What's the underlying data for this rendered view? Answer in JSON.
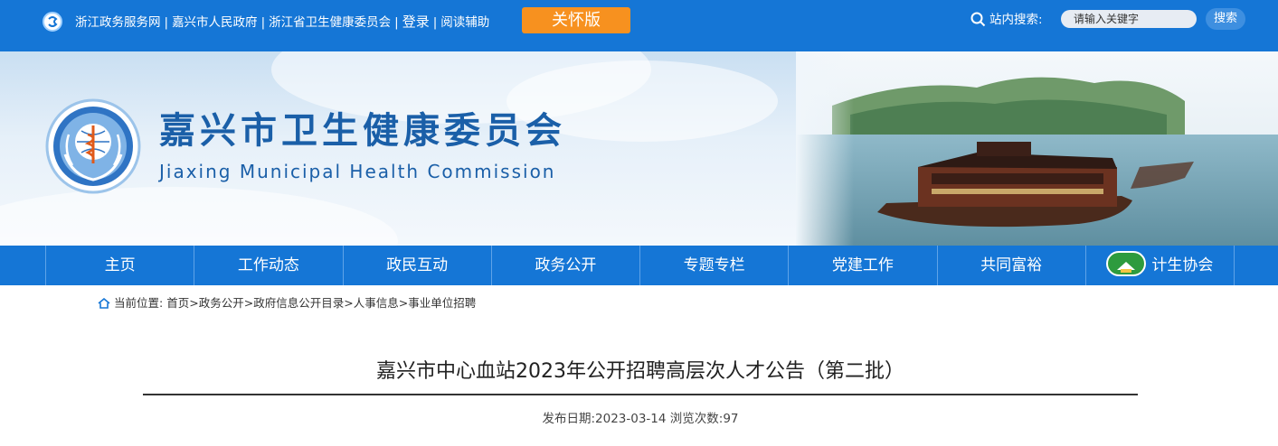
{
  "topbar": {
    "links": [
      "浙江政务服务网",
      "嘉兴市人民政府",
      "浙江省卫生健康委员会",
      "登录",
      "阅读辅助"
    ],
    "care_button": "关怀版",
    "search_label": "站内搜索:",
    "search_placeholder": "请输入关键字",
    "search_button": "搜索",
    "color": "#1576d6",
    "care_color": "#f7911f"
  },
  "banner": {
    "title_cn": "嘉兴市卫生健康委员会",
    "title_en": "Jiaxing Municipal Health Commission",
    "title_color": "#1a5fa8"
  },
  "nav": {
    "items": [
      "主页",
      "工作动态",
      "政民互动",
      "政务公开",
      "专题专栏",
      "党建工作",
      "共同富裕",
      "计生协会"
    ]
  },
  "breadcrumb": {
    "label": "当前位置:",
    "path": [
      "首页",
      "政务公开",
      "政府信息公开目录",
      "人事信息",
      "事业单位招聘"
    ],
    "separator": ">"
  },
  "article": {
    "title": "嘉兴市中心血站2023年公开招聘高层次人才公告（第二批）",
    "date_label": "发布日期:",
    "date": "2023-03-14",
    "views_label": "浏览次数:",
    "views": "97"
  }
}
